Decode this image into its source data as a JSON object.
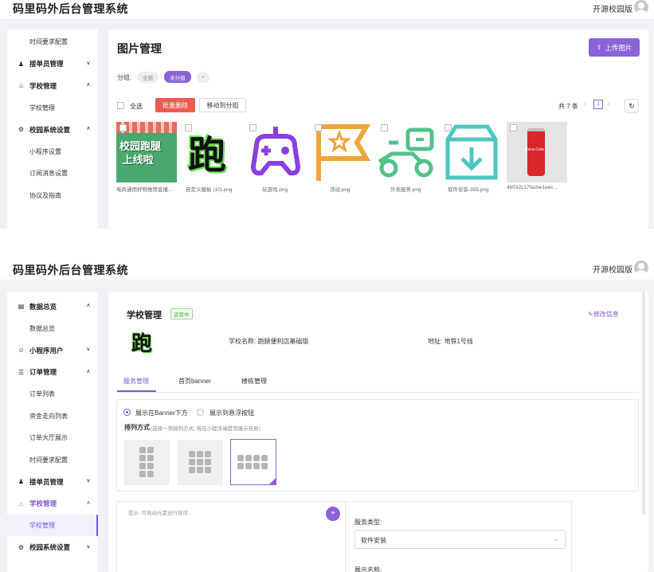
{
  "app": {
    "brand": "码里码外后台管理系统",
    "edition": "开源校园版"
  },
  "screen1": {
    "sidebar": {
      "items": [
        {
          "type": "sub",
          "label": "时间要求配置"
        },
        {
          "type": "group",
          "label": "接单员管理",
          "icon": "courier-icon",
          "arrow": "˅"
        },
        {
          "type": "group",
          "label": "学校管理",
          "icon": "school-icon",
          "arrow": "˄"
        },
        {
          "type": "sub",
          "label": "学校管理"
        },
        {
          "type": "group",
          "label": "校园系统设置",
          "icon": "settings-icon",
          "arrow": "˄"
        },
        {
          "type": "sub",
          "label": "小程序设置"
        },
        {
          "type": "sub",
          "label": "订阅消息设置"
        },
        {
          "type": "sub",
          "label": "协议及指南"
        }
      ]
    },
    "page_title": "图片管理",
    "upload_label": "上传图片",
    "group_label": "分组:",
    "groups": [
      "全部",
      "未分组",
      "+"
    ],
    "active_group": 1,
    "select_all_label": "全选",
    "batch_delete_label": "批量删除",
    "move_group_label": "移动到分组",
    "total_label": "共 7 条",
    "page_prev": "‹",
    "page_current": "1",
    "page_next": "›",
    "refresh_icon": "refresh-icon",
    "images": [
      {
        "caption": "电商通用好物推荐直播...",
        "text": "校园跑腿上线啦"
      },
      {
        "caption": "自定义模板 (10).png",
        "text": "跑"
      },
      {
        "caption": "玩游戏.png",
        "icon": "gamepad-icon"
      },
      {
        "caption": "活动.png",
        "icon": "star-flag-icon"
      },
      {
        "caption": "外卖服务.png",
        "icon": "scooter-icon"
      },
      {
        "caption": "软件安装-355.png",
        "icon": "download-box-icon"
      },
      {
        "caption": "4b032c17facbe1eec...",
        "icon": "cola-can-icon",
        "text": "Coca-Cola"
      }
    ],
    "colors": {
      "accent": "#8a63d8",
      "danger": "#ee5a52",
      "game": "#8a3fe0",
      "flag": "#f0a53a",
      "scooter": "#52c28a",
      "box": "#4fc6c3",
      "can": "#d8262a"
    }
  },
  "screen2": {
    "sidebar": {
      "items": [
        {
          "type": "group",
          "label": "数据总览",
          "icon": "dashboard-icon",
          "arrow": "˄"
        },
        {
          "type": "sub",
          "label": "数据总览"
        },
        {
          "type": "group",
          "label": "小程序用户",
          "icon": "users-icon",
          "arrow": "˅"
        },
        {
          "type": "group",
          "label": "订单管理",
          "icon": "orders-icon",
          "arrow": "˄"
        },
        {
          "type": "sub",
          "label": "订单列表"
        },
        {
          "type": "sub",
          "label": "资金走向列表"
        },
        {
          "type": "sub",
          "label": "订单大厅展示"
        },
        {
          "type": "sub",
          "label": "时间要求配置"
        },
        {
          "type": "group",
          "label": "接单员管理",
          "icon": "courier-icon",
          "arrow": "˅"
        },
        {
          "type": "group",
          "label": "学校管理",
          "icon": "school-icon",
          "arrow": "˄",
          "active": true
        },
        {
          "type": "sub",
          "label": "学校管理",
          "active": true
        },
        {
          "type": "group",
          "label": "校园系统设置",
          "icon": "settings-icon",
          "arrow": "˅"
        }
      ]
    },
    "school_title": "学校管理",
    "status_badge": "运营中",
    "edit_label": "修改信息",
    "logo_text": "跑",
    "school_name_label": "学校名称: 跑腿便利店基础版",
    "address_label": "地址: 地铁1号线",
    "tabs": [
      "服务管理",
      "首页banner",
      "楼栋管理"
    ],
    "active_tab": 0,
    "radio_options": [
      "展示在Banner下方",
      "展示到悬浮按钮"
    ],
    "radio_selected": 0,
    "arrange_label": "排列方式",
    "arrange_hint": "(选择一项排列方式, 将在小程序端首页展示布局)",
    "layouts": [
      "2x4",
      "3x3",
      "4x2"
    ],
    "layout_selected": 2,
    "drag_hint": "提示: 可拖动元素进行排序",
    "add_icon": "+",
    "service_type_label": "服务类型:",
    "service_type_value": "软件安装",
    "display_name_label": "展示名称:"
  }
}
